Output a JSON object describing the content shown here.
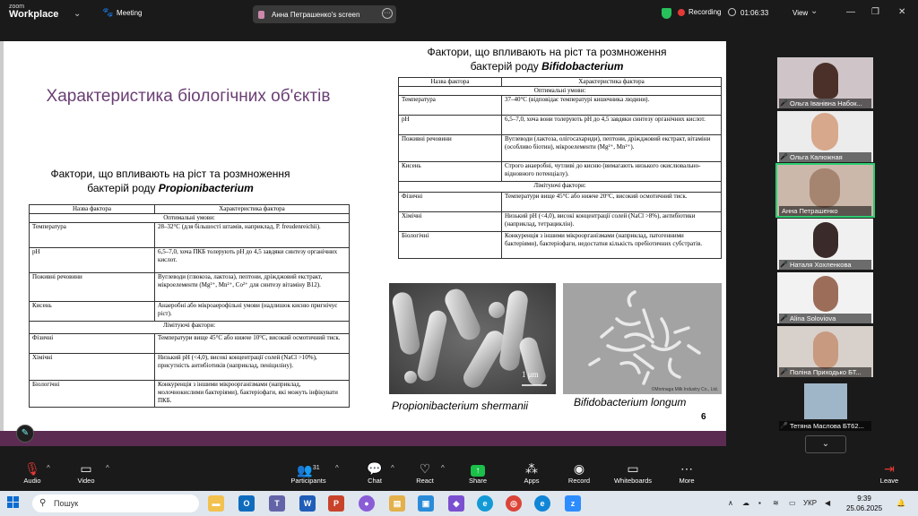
{
  "topbar": {
    "logo_line1": "zoom",
    "logo_line2": "Workplace",
    "meeting_label": "Meeting",
    "share_tab_label": "Анна Петрашенко's screen",
    "recording_label": "Recording",
    "timer": "01:06:33",
    "view_label": "View"
  },
  "slide": {
    "title": "Характеристика біологічних об'єктів",
    "number": "6",
    "left": {
      "heading_line1": "Фактори, що впливають на ріст та розмноження",
      "heading_line2_prefix": "бактерій роду ",
      "heading_line2_genus": "Propionibacterium",
      "col1": "Назва фактора",
      "col2": "Характеристика фактора",
      "optimal_label": "Оптимальні умови:",
      "limiting_label": "Лімітуючі фактори:",
      "optimal_rows": [
        {
          "name": "Температура",
          "desc": "28–32°C (для більшості штамів, наприклад, P. freudenreichii)."
        },
        {
          "name": "pH",
          "desc": "6,5–7,0, хоча ПКБ толерують pH до 4,5 завдяки синтезу органічних кислот."
        },
        {
          "name": "Поживні речовини",
          "desc": "Вуглеводи (глюкоза, лактоза), пептони, дріжджовий екстракт, мікроелементи (Mg²⁺, Mn²⁺, Co²⁺ для синтезу вітаміну B12)."
        },
        {
          "name": "Кисень",
          "desc": "Анаеробні або мікроаерофільні умови (надлишок кисню пригнічує ріст)."
        }
      ],
      "limiting_rows": [
        {
          "name": "Фізичні",
          "desc": "Температури вище 45°C або нижче 10°C, високий осмотичний тиск."
        },
        {
          "name": "Хімічні",
          "desc": "Низький pH (<4,0), високі концентрації солей (NaCl >10%), присутність антибіотиків (наприклад, пеніциліну)."
        },
        {
          "name": "Біологічні",
          "desc": "Конкуренція з іншими мікроорганізмами (наприклад, молочнокислими бактеріями), бактеріофаги, які можуть інфікувати ПКБ."
        }
      ]
    },
    "right": {
      "heading_line1": "Фактори, що впливають на ріст та розмноження",
      "heading_line2_prefix": "бактерій роду ",
      "heading_line2_genus": "Bifidobacterium",
      "col1": "Назва фактора",
      "col2": "Характеристика фактора",
      "optimal_label": "Оптимальні умови:",
      "limiting_label": "Лімітуючі фактори:",
      "optimal_rows": [
        {
          "name": "Температура",
          "desc": "37–40°C (відповідає температурі кишечника людини)."
        },
        {
          "name": "pH",
          "desc": "6,5–7,0, хоча вони толерують pH до 4,5 завдяки синтезу органічних кислот."
        },
        {
          "name": "Поживні речовини",
          "desc": "Вуглеводи (лактоза, олігосахариди), пептони, дріжджовий екстракт, вітаміни (особливо біотин), мікроелементи (Mg²⁺, Mn²⁺)."
        },
        {
          "name": "Кисень",
          "desc": "Строго анаеробні, чутливі до кисню (вимагають низького окислювально-відновного потенціалу)."
        }
      ],
      "limiting_rows": [
        {
          "name": "Фізичні",
          "desc": "Температури вище 45°C або нижче 20°C, високий осмотичний тиск."
        },
        {
          "name": "Хімічні",
          "desc": "Низький pH (<4,0), високі концентрації солей (NaCl >8%), антибіотики (наприклад, тетрациклін)."
        },
        {
          "name": "Біологічні",
          "desc": "Конкуренція з іншими мікроорганізмами (наприклад, патогенними бактеріями), бактеріофаги, недостатня кількість пребіотичних субстратів."
        }
      ]
    },
    "photo1_scale": "1 μm",
    "photo2_credit": "©Morinaga Milk Industry Co., Ltd.",
    "caption1": "Propionibacterium shermanii",
    "caption2": "Bifidobacterium longum"
  },
  "gallery": [
    {
      "name": "Ольга Іванівна Набок..."
    },
    {
      "name": "Ольга Калюжная"
    },
    {
      "name": "Анна Петрашенко"
    },
    {
      "name": "Наталя Хохленкова"
    },
    {
      "name": "Alina Soloviova"
    },
    {
      "name": "Поліна Приходько БТ..."
    },
    {
      "name": "Тетяна Маслова БТ62..."
    }
  ],
  "toolbar": {
    "audio": "Audio",
    "video": "Video",
    "participants": "Participants",
    "participants_count": "31",
    "chat": "Chat",
    "react": "React",
    "share": "Share",
    "apps": "Apps",
    "record": "Record",
    "whiteboards": "Whiteboards",
    "more": "More",
    "leave": "Leave"
  },
  "taskbar": {
    "search_placeholder": "Пошук",
    "lang": "УКР",
    "time": "9:39",
    "date": "25.06.2025"
  }
}
